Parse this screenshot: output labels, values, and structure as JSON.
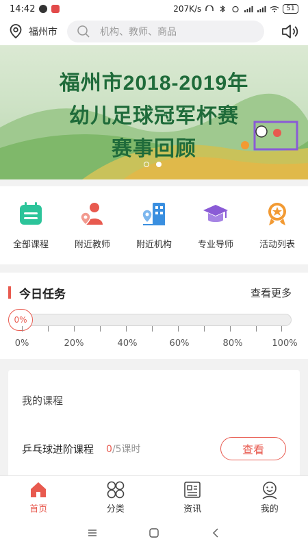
{
  "status": {
    "time": "14:42",
    "speed": "207K/s",
    "battery": "51"
  },
  "search": {
    "city": "福州市",
    "placeholder": "机构、教师、商品"
  },
  "banner": {
    "line1": "福州市2018-2019年",
    "line2": "幼儿足球冠军杯赛",
    "line3": "赛事回顾",
    "slides": 2,
    "active_slide": 2
  },
  "quick": [
    {
      "label": "全部课程",
      "icon": "calendar-icon",
      "color": "#2cc49a"
    },
    {
      "label": "附近教师",
      "icon": "teacher-location-icon",
      "color": "#e85a4f"
    },
    {
      "label": "附近机构",
      "icon": "building-location-icon",
      "color": "#3a8fe0"
    },
    {
      "label": "专业导师",
      "icon": "graduation-cap-icon",
      "color": "#8a5bd6"
    },
    {
      "label": "活动列表",
      "icon": "medal-icon",
      "color": "#f29a33"
    }
  ],
  "task": {
    "title": "今日任务",
    "more": "查看更多",
    "percent_label": "0%",
    "progress": 0,
    "scale": [
      "0%",
      "20%",
      "40%",
      "60%",
      "80%",
      "100%"
    ]
  },
  "course": {
    "header": "我的课程",
    "name": "乒乓球进阶课程",
    "done": "0",
    "total": "/5课时",
    "button": "查看"
  },
  "tabs": [
    {
      "label": "首页",
      "icon": "home-icon"
    },
    {
      "label": "分类",
      "icon": "category-icon"
    },
    {
      "label": "资讯",
      "icon": "news-icon"
    },
    {
      "label": "我的",
      "icon": "profile-icon"
    }
  ],
  "colors": {
    "accent": "#e85a4f",
    "banner_text": "#1f6b3a"
  }
}
